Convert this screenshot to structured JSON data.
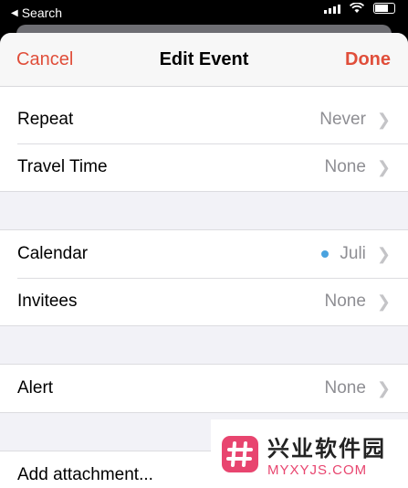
{
  "status_bar": {
    "back_label": "Search"
  },
  "nav": {
    "cancel": "Cancel",
    "title": "Edit Event",
    "done": "Done"
  },
  "group1": [
    {
      "label": "Repeat",
      "value": "Never"
    },
    {
      "label": "Travel Time",
      "value": "None"
    }
  ],
  "group2": [
    {
      "label": "Calendar",
      "value": "Juli",
      "dot_color": "#4aa3df"
    },
    {
      "label": "Invitees",
      "value": "None"
    }
  ],
  "group3": [
    {
      "label": "Alert",
      "value": "None"
    }
  ],
  "group4": [
    {
      "label": "Add attachment..."
    }
  ],
  "watermark": {
    "cn": "兴业软件园",
    "en": "MYXYJS.COM"
  },
  "colors": {
    "accent": "#e04e3a",
    "calendar_dot": "#4aa3df"
  }
}
